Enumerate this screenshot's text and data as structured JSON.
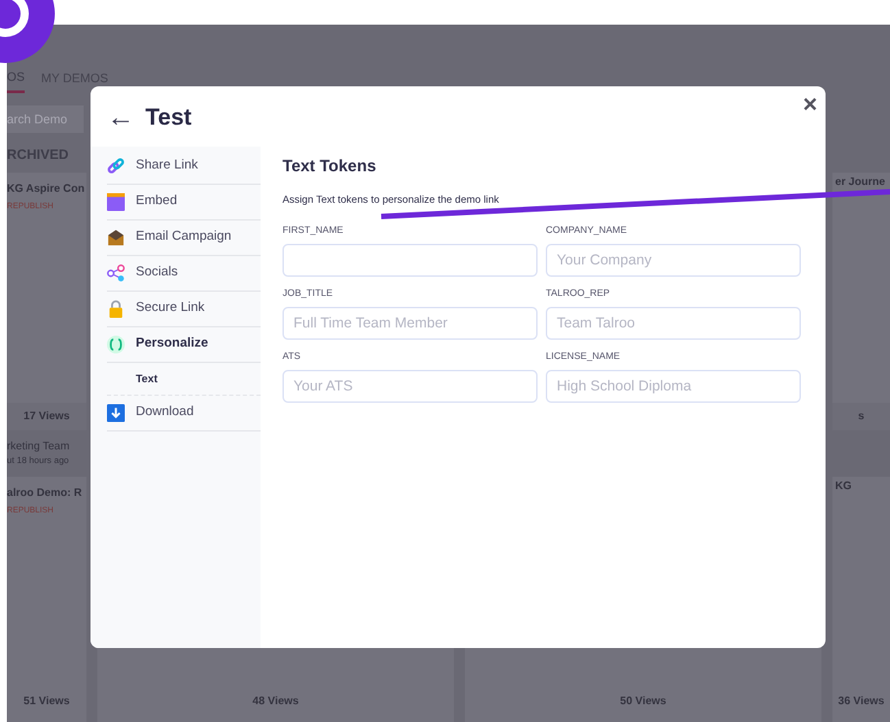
{
  "background": {
    "tabs": [
      {
        "label": "OS",
        "selected": true
      },
      {
        "label": "MY DEMOS",
        "selected": false
      }
    ],
    "search": {
      "placeholder": "arch Demo"
    },
    "filter": "RCHIVED",
    "top_cards": [
      {
        "title": "KG Aspire Con",
        "status": "REPUBLISH",
        "views": "17 Views"
      },
      {
        "title": "er Journe",
        "views": "s"
      }
    ],
    "activity": {
      "name": "rketing Team",
      "time": "ut 18 hours ago"
    },
    "bottom_cards": [
      {
        "title": "alroo Demo: R",
        "status": "REPUBLISH",
        "views": "51 Views"
      },
      {
        "views": "48 Views"
      },
      {
        "views": "50 Views"
      },
      {
        "title": "KG",
        "views": "36 Views"
      }
    ]
  },
  "modal": {
    "title": "Test",
    "back": "←",
    "close": "×",
    "sidebar": [
      {
        "label": "Share Link",
        "selected": false
      },
      {
        "label": "Embed",
        "selected": false
      },
      {
        "label": "Email Campaign",
        "selected": false
      },
      {
        "label": "Socials",
        "selected": false
      },
      {
        "label": "Secure Link",
        "selected": false
      },
      {
        "label": "Personalize",
        "selected": true,
        "children": [
          {
            "label": "Text",
            "selected": true
          }
        ]
      },
      {
        "label": "Download",
        "selected": false
      }
    ],
    "heading": "Text Tokens",
    "description": "Assign Text tokens to personalize the demo link",
    "fields": [
      {
        "label": "FIRST_NAME"
      },
      {
        "label": "COMPANY_NAME",
        "placeholder": "Your Company"
      },
      {
        "label": "JOB_TITLE",
        "placeholder": "Full Time Team Member"
      },
      {
        "label": "TALROO_REP",
        "placeholder": "Team Talroo"
      },
      {
        "label": "ATS",
        "placeholder": "Your ATS"
      },
      {
        "label": "LICENSE_NAME",
        "placeholder": "High School Diploma"
      }
    ]
  }
}
